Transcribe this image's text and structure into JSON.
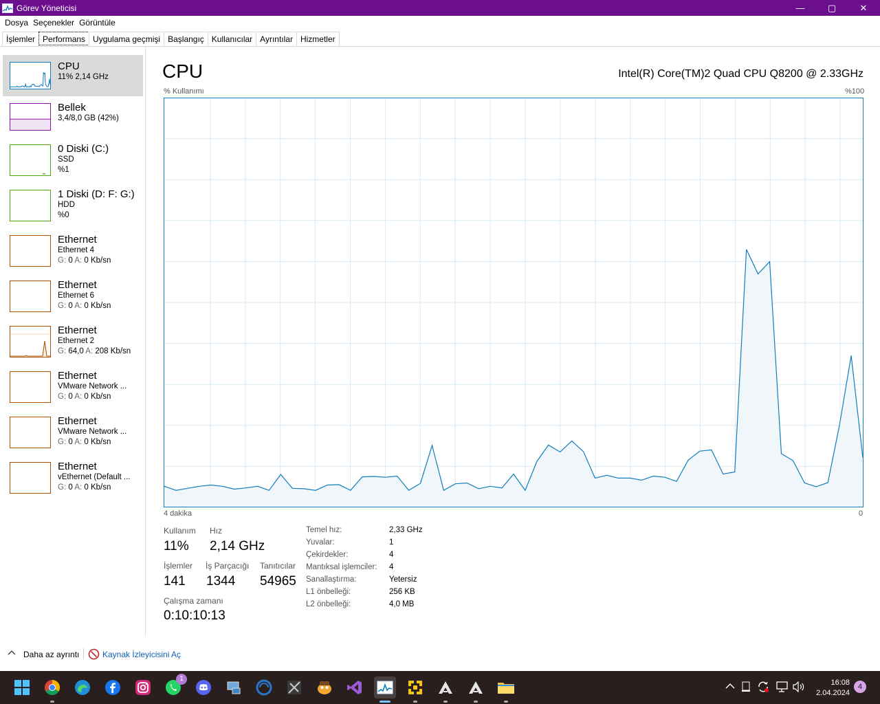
{
  "window": {
    "title": "Görev Yöneticisi",
    "minimize": "—",
    "maximize": "▢",
    "close": "✕"
  },
  "menu": [
    "Dosya",
    "Seçenekler",
    "Görüntüle"
  ],
  "tabs": [
    "İşlemler",
    "Performans",
    "Uygulama geçmişi",
    "Başlangıç",
    "Kullanıcılar",
    "Ayrıntılar",
    "Hizmetler"
  ],
  "active_tab": "Performans",
  "sidebar": [
    {
      "name": "CPU",
      "sub1": "11% 2,14 GHz",
      "sub2": "",
      "color": "#117dbb"
    },
    {
      "name": "Bellek",
      "sub1": "3,4/8,0 GB (42%)",
      "sub2": "",
      "color": "#8b12ae"
    },
    {
      "name": "0 Diski (C:)",
      "sub1": "SSD",
      "sub2": "%1",
      "color": "#4da60c"
    },
    {
      "name": "1 Diski (D: F: G:)",
      "sub1": "HDD",
      "sub2": "%0",
      "color": "#4da60c"
    },
    {
      "name": "Ethernet",
      "sub1": "Ethernet 4",
      "g": "0",
      "a": "0 Kb/sn",
      "color": "#a74f01"
    },
    {
      "name": "Ethernet",
      "sub1": "Ethernet 6",
      "g": "0",
      "a": "0 Kb/sn",
      "color": "#a74f01"
    },
    {
      "name": "Ethernet",
      "sub1": "Ethernet 2",
      "g": "64,0",
      "a": "208 Kb/sn",
      "color": "#a74f01"
    },
    {
      "name": "Ethernet",
      "sub1": "VMware Network ...",
      "g": "0",
      "a": "0 Kb/sn",
      "color": "#a74f01"
    },
    {
      "name": "Ethernet",
      "sub1": "VMware Network ...",
      "g": "0",
      "a": "0 Kb/sn",
      "color": "#a74f01"
    },
    {
      "name": "Ethernet",
      "sub1": "vEthernet (Default ...",
      "g": "0",
      "a": "0 Kb/sn",
      "color": "#a74f01"
    }
  ],
  "net_labels": {
    "g": "G:",
    "a": "A:"
  },
  "main": {
    "title": "CPU",
    "model": "Intel(R) Core(TM)2 Quad CPU Q8200 @ 2.33GHz",
    "usage_label": "% Kullanımı",
    "max_label": "%100",
    "time_label": "4 dakika",
    "zero_label": "0"
  },
  "stats": {
    "usage_lbl": "Kullanım",
    "usage": "11%",
    "speed_lbl": "Hız",
    "speed": "2,14 GHz",
    "proc_lbl": "İşlemler",
    "proc": "141",
    "threads_lbl": "İş Parçacığı",
    "threads": "1344",
    "handles_lbl": "Tanıtıcılar",
    "handles": "54965",
    "uptime_lbl": "Çalışma zamanı",
    "uptime": "0:10:10:13"
  },
  "info": [
    {
      "k": "Temel hız:",
      "v": "2,33 GHz"
    },
    {
      "k": "Yuvalar:",
      "v": "1"
    },
    {
      "k": "Çekirdekler:",
      "v": "4"
    },
    {
      "k": "Mantıksal işlemciler:",
      "v": "4"
    },
    {
      "k": "Sanallaştırma:",
      "v": "Yetersiz"
    },
    {
      "k": "L1 önbelleği:",
      "v": "256 KB"
    },
    {
      "k": "L2 önbelleği:",
      "v": "4,0 MB"
    }
  ],
  "footer": {
    "less": "Daha az ayrıntı",
    "resmon": "Kaynak İzleyicisini Aç"
  },
  "cpu_series": [
    5,
    4,
    4.5,
    5,
    5.3,
    5,
    4.3,
    4.6,
    5,
    4,
    7.9,
    4.5,
    4.4,
    4,
    5.3,
    5.4,
    4,
    7.3,
    7.4,
    7.2,
    7.5,
    4,
    5.7,
    15,
    4,
    5.6,
    5.8,
    4.4,
    5,
    4.6,
    8,
    4,
    11.1,
    15.1,
    13.4,
    16.1,
    13.5,
    7,
    7.7,
    7,
    7,
    6.5,
    7.5,
    7.2,
    6.2,
    11.4,
    13.6,
    13.9,
    8,
    8.5,
    63,
    57,
    60,
    13,
    11.3,
    5.8,
    4.9,
    5.9,
    20,
    37,
    12
  ],
  "taskbar": {
    "badge_whatsapp": "1",
    "time": "16:08",
    "date": "2.04.2024",
    "notifications": "4"
  }
}
